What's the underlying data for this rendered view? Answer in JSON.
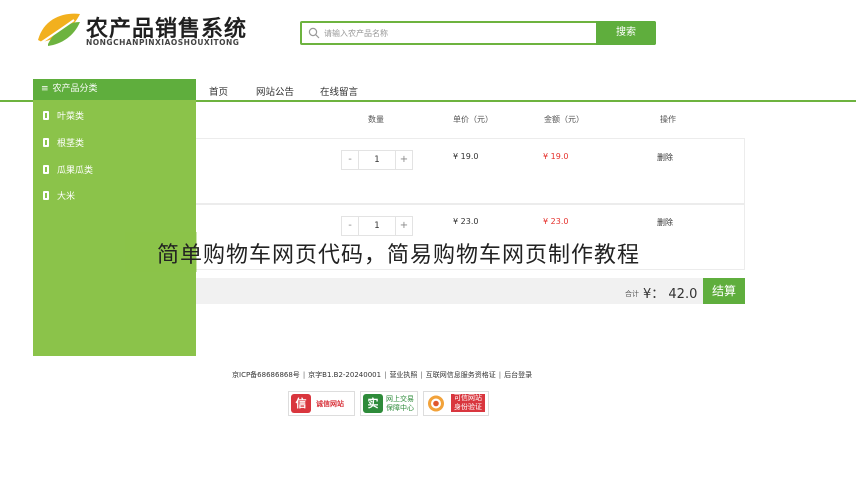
{
  "header": {
    "logo_title": "农产品销售系统",
    "logo_subtitle": "NONGCHANPINXIAOSHOUXITONG",
    "search_placeholder": "请输入农产品名称",
    "search_button": "搜索"
  },
  "nav": {
    "items": [
      "首页",
      "网站公告",
      "在线留言"
    ]
  },
  "sidebar": {
    "title": "农产品分类",
    "categories": [
      "叶菜类",
      "根茎类",
      "瓜果瓜类",
      "大米"
    ]
  },
  "cart": {
    "columns": [
      "数量",
      "单价（元）",
      "金额（元）",
      "操作"
    ],
    "rows": [
      {
        "qty": "1",
        "price": "¥ 19.0",
        "amount": "¥ 19.0",
        "action": "删除"
      },
      {
        "qty": "1",
        "price": "¥ 23.0",
        "amount": "¥ 23.0",
        "action": "删除"
      }
    ],
    "minus": "-",
    "plus": "+",
    "total_label": "合计",
    "total_value": "¥： 42.0",
    "checkout": "结算"
  },
  "overlay_text": "简单购物车网页代码，简易购物车网页制作教程",
  "footer": {
    "links": [
      "京ICP备68686868号",
      "京字B1.B2-20240001",
      "营业执照",
      "互联网信息服务资格证",
      "后台登录"
    ],
    "badges": [
      {
        "icon": "信",
        "text": "诚信网站",
        "color": "#d9363e"
      },
      {
        "icon": "实",
        "text1": "网上交易",
        "text2": "保障中心",
        "color": "#2e8b3a"
      },
      {
        "icon": "",
        "text1": "可信网站",
        "text2": "身份验证",
        "color": "#d9363e"
      }
    ]
  },
  "colors": {
    "brand_green": "#5fae3d",
    "sidebar_green": "#8bc34a",
    "price_red": "#e5322d"
  }
}
